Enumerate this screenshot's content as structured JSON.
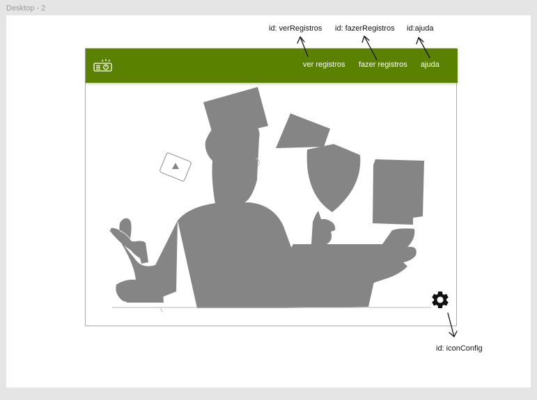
{
  "canvas": {
    "frame_label": "Desktop - 2"
  },
  "annotations": {
    "ver_registros": "id: verRegistros",
    "fazer_registros": "id: fazerRegistros",
    "ajuda": "id:ajuda",
    "icon_config": "id: iconConfig"
  },
  "navbar": {
    "color": "#5a8100",
    "logo_icon": "projector-icon",
    "links": {
      "ver_registros": "ver registros",
      "fazer_registros": "fazer registros",
      "ajuda": "ajuda"
    }
  },
  "main": {
    "illustration_color": "#858585",
    "settings_icon": "gear-icon"
  }
}
